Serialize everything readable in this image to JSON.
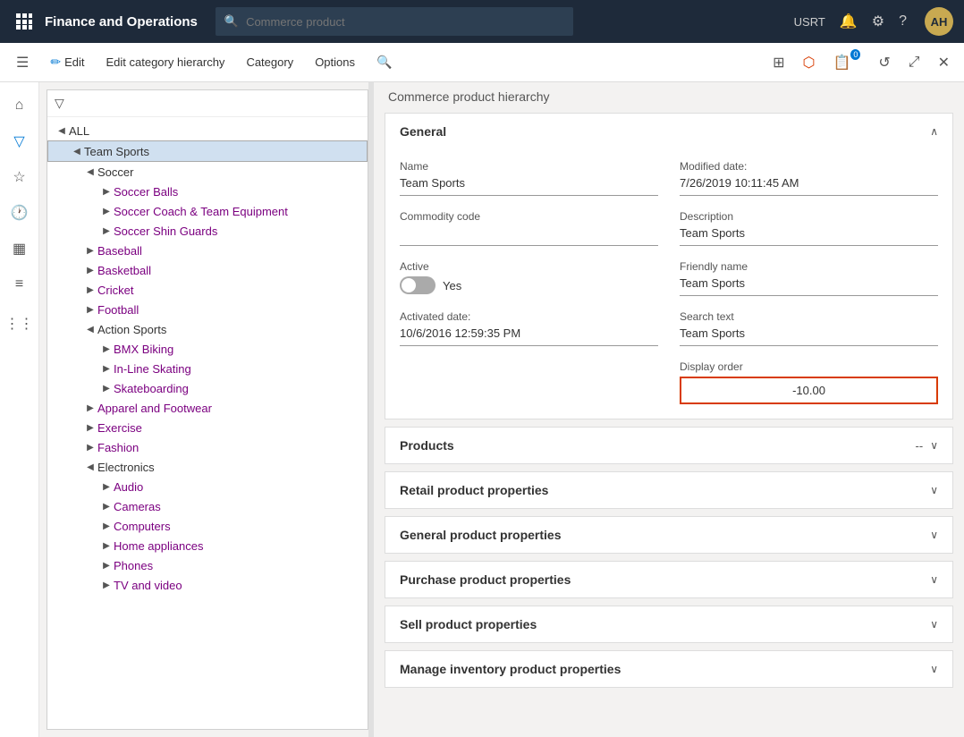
{
  "topNav": {
    "appTitle": "Finance and Operations",
    "searchPlaceholder": "Commerce product",
    "username": "USRT"
  },
  "toolbar": {
    "editLabel": "Edit",
    "editHierarchyLabel": "Edit category hierarchy",
    "categoryLabel": "Category",
    "optionsLabel": "Options"
  },
  "detailHeader": "Commerce product hierarchy",
  "general": {
    "sectionTitle": "General",
    "nameLabel": "Name",
    "nameValue": "Team Sports",
    "modifiedDateLabel": "Modified date:",
    "modifiedDateValue": "7/26/2019 10:11:45 AM",
    "commodityCodeLabel": "Commodity code",
    "commodityCodeValue": "",
    "descriptionLabel": "Description",
    "descriptionValue": "Team Sports",
    "activeLabel": "Active",
    "activeValue": "Yes",
    "friendlyNameLabel": "Friendly name",
    "friendlyNameValue": "Team Sports",
    "activatedDateLabel": "Activated date:",
    "activatedDateValue": "10/6/2016 12:59:35 PM",
    "searchTextLabel": "Search text",
    "searchTextValue": "Team Sports",
    "displayOrderLabel": "Display order",
    "displayOrderValue": "-10.00"
  },
  "sections": [
    {
      "title": "Products",
      "badge": "--",
      "collapsed": true
    },
    {
      "title": "Retail product properties",
      "badge": "",
      "collapsed": true
    },
    {
      "title": "General product properties",
      "badge": "",
      "collapsed": true
    },
    {
      "title": "Purchase product properties",
      "badge": "",
      "collapsed": true
    },
    {
      "title": "Sell product properties",
      "badge": "",
      "collapsed": true
    },
    {
      "title": "Manage inventory product properties",
      "badge": "",
      "collapsed": true
    }
  ],
  "tree": {
    "rootLabel": "ALL",
    "items": [
      {
        "label": "Team Sports",
        "level": 1,
        "expanded": true,
        "selected": true,
        "hasChildren": true
      },
      {
        "label": "Soccer",
        "level": 2,
        "expanded": true,
        "hasChildren": true
      },
      {
        "label": "Soccer Balls",
        "level": 3,
        "hasChildren": true,
        "isLink": true
      },
      {
        "label": "Soccer Coach & Team Equipment",
        "level": 3,
        "hasChildren": true,
        "isLink": true
      },
      {
        "label": "Soccer Shin Guards",
        "level": 3,
        "hasChildren": true,
        "isLink": true
      },
      {
        "label": "Baseball",
        "level": 2,
        "hasChildren": true,
        "isLink": true
      },
      {
        "label": "Basketball",
        "level": 2,
        "hasChildren": true,
        "isLink": true
      },
      {
        "label": "Cricket",
        "level": 2,
        "hasChildren": true,
        "isLink": true
      },
      {
        "label": "Football",
        "level": 2,
        "hasChildren": true,
        "isLink": true
      },
      {
        "label": "Action Sports",
        "level": 2,
        "expanded": true,
        "hasChildren": true
      },
      {
        "label": "BMX Biking",
        "level": 3,
        "hasChildren": true,
        "isLink": true
      },
      {
        "label": "In-Line Skating",
        "level": 3,
        "hasChildren": true,
        "isLink": true
      },
      {
        "label": "Skateboarding",
        "level": 3,
        "hasChildren": true,
        "isLink": true
      },
      {
        "label": "Apparel and Footwear",
        "level": 2,
        "hasChildren": true,
        "isLink": true
      },
      {
        "label": "Exercise",
        "level": 2,
        "hasChildren": true,
        "isLink": true
      },
      {
        "label": "Fashion",
        "level": 2,
        "hasChildren": true,
        "isLink": true
      },
      {
        "label": "Electronics",
        "level": 2,
        "expanded": true,
        "hasChildren": true
      },
      {
        "label": "Audio",
        "level": 3,
        "hasChildren": true,
        "isLink": true
      },
      {
        "label": "Cameras",
        "level": 3,
        "hasChildren": true,
        "isLink": true
      },
      {
        "label": "Computers",
        "level": 3,
        "hasChildren": true,
        "isLink": true
      },
      {
        "label": "Home appliances",
        "level": 3,
        "hasChildren": true,
        "isLink": true
      },
      {
        "label": "Phones",
        "level": 3,
        "hasChildren": true,
        "isLink": true
      },
      {
        "label": "TV and video",
        "level": 3,
        "hasChildren": true,
        "isLink": true
      }
    ]
  }
}
